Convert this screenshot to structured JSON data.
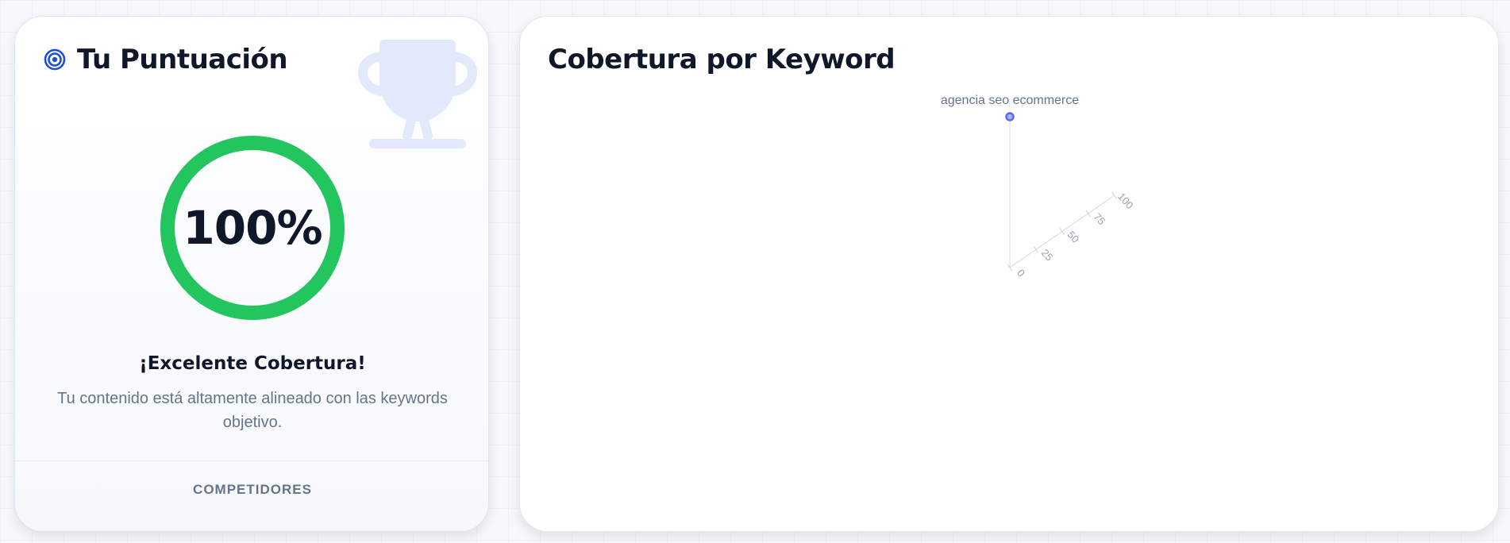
{
  "score_card": {
    "title": "Tu Puntuación",
    "score": "100%",
    "score_fraction": 1.0,
    "status_title": "¡Excelente Cobertura!",
    "status_text": "Tu contenido está altamente alineado con las keywords objetivo.",
    "competitors_label": "COMPETIDORES",
    "ring_color": "#22c55e",
    "icons": {
      "header": "target-icon",
      "background": "trophy-icon"
    }
  },
  "coverage_card": {
    "title": "Cobertura por Keyword"
  },
  "chart_data": {
    "type": "radar",
    "categories": [
      "agencia seo ecommerce"
    ],
    "series": [
      {
        "values": [
          100
        ],
        "color": "#6366f1"
      }
    ],
    "radial_ticks": [
      "0",
      "25",
      "50",
      "75",
      "100"
    ],
    "range": [
      0,
      100
    ],
    "grid": true
  }
}
